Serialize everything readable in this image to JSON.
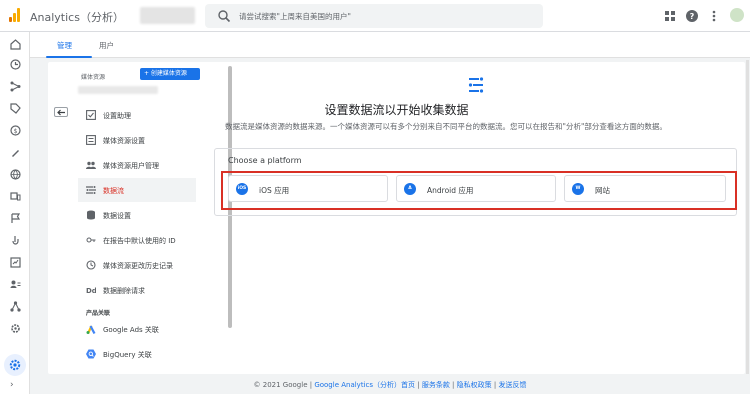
{
  "header": {
    "app_title": "Analytics（分析）",
    "search_placeholder": "请尝试搜索\"上周来自美国的用户\"",
    "icons": [
      "apps-grid-icon",
      "help-icon",
      "more-vert-icon"
    ]
  },
  "tabs": [
    {
      "label": "管理",
      "active": true
    },
    {
      "label": "用户",
      "active": false
    }
  ],
  "property_nav": {
    "label": "媒体资源",
    "create_button": "+ 创建媒体资源",
    "items": [
      {
        "label": "设置助理",
        "icon": "checkbox-icon"
      },
      {
        "label": "媒体资源设置",
        "icon": "property-settings-icon"
      },
      {
        "label": "媒体资源用户管理",
        "icon": "people-icon"
      },
      {
        "label": "数据流",
        "icon": "data-streams-icon",
        "active": true
      },
      {
        "label": "数据设置",
        "icon": "database-icon"
      },
      {
        "label": "在报告中默认使用的 ID",
        "icon": "id-icon"
      },
      {
        "label": "媒体资源更改历史记录",
        "icon": "history-icon"
      },
      {
        "label": "数据删除请求",
        "icon": "data-deletion-icon"
      }
    ],
    "section_label": "产品关联",
    "links": [
      {
        "label": "Google Ads 关联",
        "icon": "google-ads-icon"
      },
      {
        "label": "BigQuery 关联",
        "icon": "bigquery-icon"
      }
    ]
  },
  "main": {
    "title": "设置数据流以开始收集数据",
    "description": "数据流是媒体资源的数据来源。一个媒体资源可以有多个分别来自不同平台的数据流。您可以在报告和\"分析\"部分查看这方面的数据。",
    "platform_title": "Choose a platform",
    "platforms": [
      {
        "label": "iOS 应用",
        "icon_text": "iOS"
      },
      {
        "label": "Android 应用",
        "icon_text": "A"
      },
      {
        "label": "网站",
        "icon_text": "W"
      }
    ]
  },
  "footer": {
    "copyright": "© 2021 Google | ",
    "links": [
      "Google Analytics（分析）首页",
      "服务条款",
      "隐私权政策",
      "发送反馈"
    ]
  },
  "colors": {
    "accent": "#1a73e8",
    "highlight": "#d93025"
  }
}
